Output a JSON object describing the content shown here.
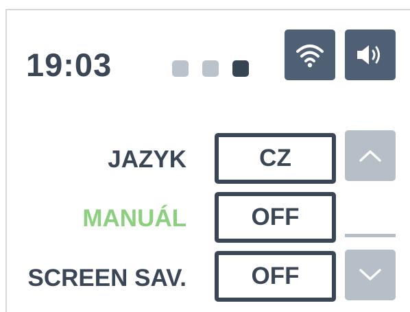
{
  "header": {
    "time": "19:03",
    "page_indicator": {
      "total": 3,
      "active_index": 3
    },
    "status_icons": [
      {
        "icon": "wifi-icon"
      },
      {
        "icon": "speaker-icon"
      }
    ]
  },
  "settings": {
    "rows": [
      {
        "label": "JAZYK",
        "value": "CZ",
        "highlighted": false
      },
      {
        "label": "MANUÁL",
        "value": "OFF",
        "highlighted": true
      },
      {
        "label": "SCREEN SAV.",
        "value": "OFF",
        "highlighted": false
      }
    ]
  },
  "scroll": {
    "up_icon": "chevron-up-icon",
    "down_icon": "chevron-down-icon"
  },
  "colors": {
    "text_dark": "#3a4655",
    "highlight_green": "#8ccf7e",
    "icon_tile": "#506074",
    "disabled_tile": "#b6bec7",
    "dot_inactive": "#bac2cb",
    "dot_active": "#374454"
  }
}
